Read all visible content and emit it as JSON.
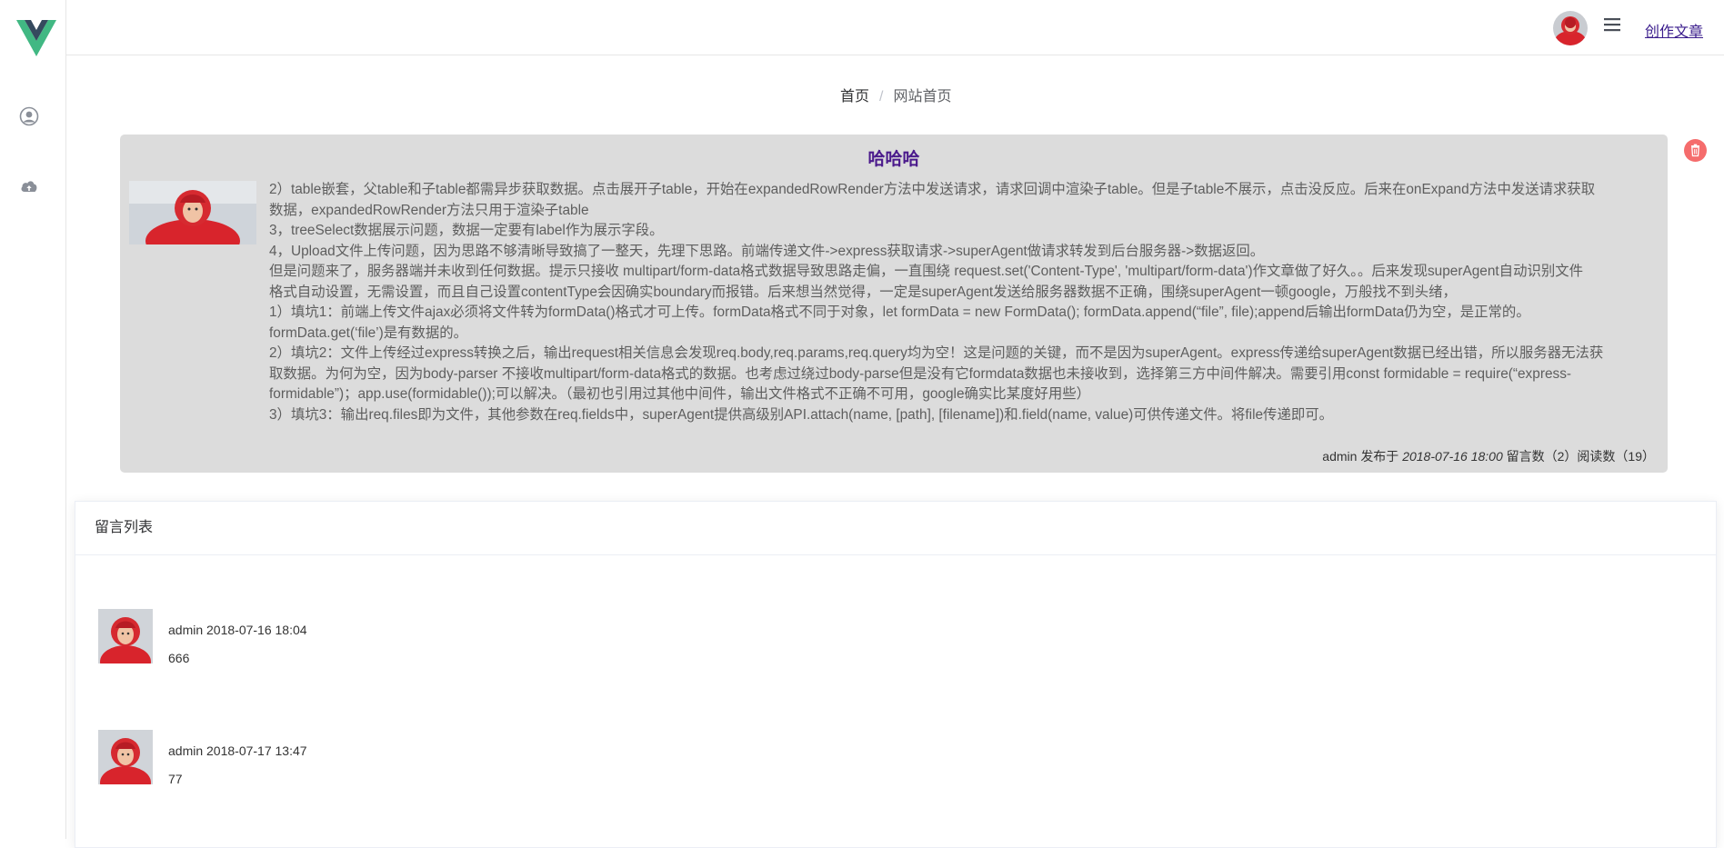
{
  "app": {
    "logo": "vue-logo"
  },
  "sidebar": {
    "items": [
      {
        "icon": "user-circle-icon"
      },
      {
        "icon": "cloud-upload-icon"
      }
    ]
  },
  "header": {
    "avatar": "user-avatar",
    "menu_icon": "hamburger-menu-icon",
    "create_label": "创作文章"
  },
  "breadcrumb": {
    "home": "首页",
    "separator": "/",
    "current": "网站首页"
  },
  "article": {
    "title": "哈哈哈",
    "paragraphs": [
      "2）table嵌套，父table和子table都需异步获取数据。点击展开子table，开始在expandedRowRender方法中发送请求，请求回调中渲染子table。但是子table不展示，点击没反应。后来在onExpand方法中发送请求获取",
      "数据，expandedRowRender方法只用于渲染子table",
      "3，treeSelect数据展示问题，数据一定要有label作为展示字段。",
      "4，Upload文件上传问题，因为思路不够清晰导致搞了一整天，先理下思路。前端传递文件->express获取请求->superAgent做请求转发到后台服务器->数据返回。",
      "但是问题来了，服务器端并未收到任何数据。提示只接收 multipart/form-data格式数据导致思路走偏，一直围绕 request.set('Content-Type', 'multipart/form-data')作文章做了好久。。后来发现superAgent自动识别文件",
      "格式自动设置，无需设置，而且自己设置contentType会因确实boundary而报错。后来想当然觉得，一定是superAgent发送给服务器数据不正确，围绕superAgent一顿google，万般找不到头绪，",
      "1）填坑1：前端上传文件ajax必须将文件转为formData()格式才可上传。formData格式不同于对象，let formData = new FormData(); formData.append(“file”, file);append后输出formData仍为空，是正常的。",
      "formData.get(‘file’)是有数据的。",
      "2）填坑2：文件上传经过express转换之后，输出request相关信息会发现req.body,req.params,req.query均为空！这是问题的关键，而不是因为superAgent。express传递给superAgent数据已经出错，所以服务器无法获",
      "取数据。为何为空，因为body-parser 不接收multipart/form-data格式的数据。也考虑过绕过body-parse但是没有它formdata数据也未接收到，选择第三方中间件解决。需要引用const formidable = require(“express-",
      "formidable”)；app.use(formidable());可以解决。（最初也引用过其他中间件，输出文件格式不正确不可用，google确实比某度好用些）",
      "3）填坑3：输出req.files即为文件，其他参数在req.fields中，superAgent提供高级别API.attach(name, [path], [filename])和.field(name, value)可供传递文件。将file传递即可。"
    ],
    "meta": {
      "author": "admin",
      "posted_label": "发布于",
      "date": "2018-07-16 18:00",
      "stats": "留言数（2）阅读数（19）"
    },
    "delete_icon": "trash-icon"
  },
  "comments": {
    "header": "留言列表",
    "items": [
      {
        "author_date": "admin 2018-07-16 18:04",
        "text": "666"
      },
      {
        "author_date": "admin 2018-07-17 13:47",
        "text": "77"
      }
    ]
  },
  "colors": {
    "accent": "#3a1c8c",
    "title": "#4b1a8c",
    "delete": "#f56c6c",
    "card_bg": "#dcdcdc"
  }
}
